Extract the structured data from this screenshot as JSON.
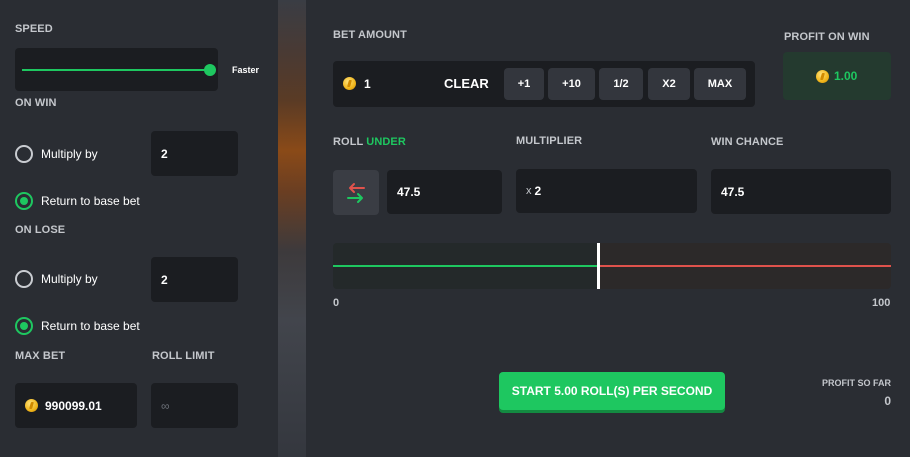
{
  "left": {
    "speed_label": "SPEED",
    "speed_value_label": "Faster",
    "speed_level": 1.0,
    "on_win_label": "ON WIN",
    "on_win": {
      "multiply_label": "Multiply by",
      "multiply_value": "2",
      "return_label": "Return to base bet",
      "selected": "return"
    },
    "on_lose_label": "ON LOSE",
    "on_lose": {
      "multiply_label": "Multiply by",
      "multiply_value": "2",
      "return_label": "Return to base bet",
      "selected": "return"
    },
    "max_bet_label": "MAX BET",
    "max_bet_value": "990099.01",
    "roll_limit_label": "ROLL LIMIT",
    "roll_limit_value": "∞"
  },
  "bet": {
    "label": "BET AMOUNT",
    "value": "1",
    "clear_label": "CLEAR",
    "buttons": [
      "+1",
      "+10",
      "1/2",
      "X2",
      "MAX"
    ]
  },
  "profit_on_win": {
    "label": "PROFIT ON WIN",
    "value": "1.00"
  },
  "roll": {
    "label_prefix": "ROLL",
    "label_mode": "UNDER",
    "value": "47.5"
  },
  "multiplier": {
    "label": "MULTIPLIER",
    "prefix": "x",
    "value": "2"
  },
  "win_chance": {
    "label": "WIN CHANCE",
    "value": "47.5"
  },
  "slider": {
    "min_label": "0",
    "max_label": "100",
    "value": 47.5,
    "min": 0,
    "max": 100
  },
  "start_button_label": "START 5.00 ROLL(S) PER SECOND",
  "profit_so_far": {
    "label": "PROFIT SO FAR",
    "value": "0"
  },
  "colors": {
    "green": "#1ec760",
    "red": "#e0524c",
    "panel": "#1b1d21",
    "bg": "#2a2d33"
  }
}
